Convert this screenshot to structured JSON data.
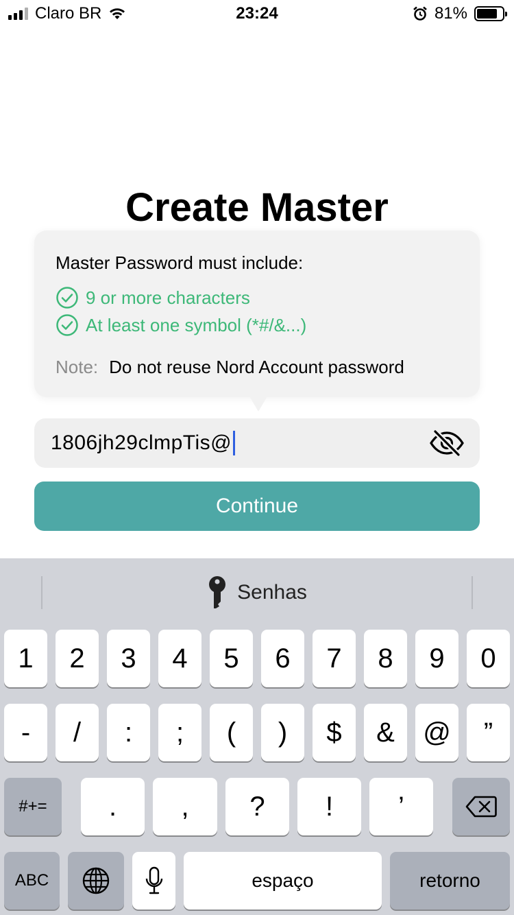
{
  "status_bar": {
    "carrier": "Claro BR",
    "time": "23:24",
    "battery_percent": "81%",
    "battery_level": 0.81,
    "signal_bars": 4,
    "signal_bars_active": 3,
    "icons": [
      "signal-icon",
      "wifi-icon",
      "alarm-icon",
      "battery-icon"
    ]
  },
  "page": {
    "title": "Create Master"
  },
  "tooltip": {
    "heading": "Master Password must include:",
    "requirements": [
      {
        "text": "9 or more characters",
        "met": true
      },
      {
        "text": "At least one symbol (*#/&...)",
        "met": true
      }
    ],
    "note_label": "Note:",
    "note_text": "Do not reuse Nord Account password"
  },
  "password_field": {
    "value": "1806jh29clmpTis@",
    "visibility_icon": "eye-slash-icon"
  },
  "continue_button": {
    "label": "Continue"
  },
  "keyboard": {
    "suggestion": "Senhas",
    "suggestion_icon": "key-icon",
    "row1": [
      "1",
      "2",
      "3",
      "4",
      "5",
      "6",
      "7",
      "8",
      "9",
      "0"
    ],
    "row2": [
      "-",
      "/",
      ":",
      ";",
      "(",
      ")",
      "$",
      "&",
      "@",
      "”"
    ],
    "row3_left": "#+=",
    "row3": [
      ".",
      ",",
      "?",
      "!",
      "’"
    ],
    "row3_right_icon": "delete-icon",
    "row4": {
      "abc": "ABC",
      "globe_icon": "globe-icon",
      "mic_icon": "microphone-icon",
      "space": "espaço",
      "return": "retorno"
    }
  },
  "colors": {
    "accent": "#4ea8a6",
    "success": "#3db878",
    "caret": "#2f5fe0",
    "keyboard_bg": "#d1d3d9"
  }
}
